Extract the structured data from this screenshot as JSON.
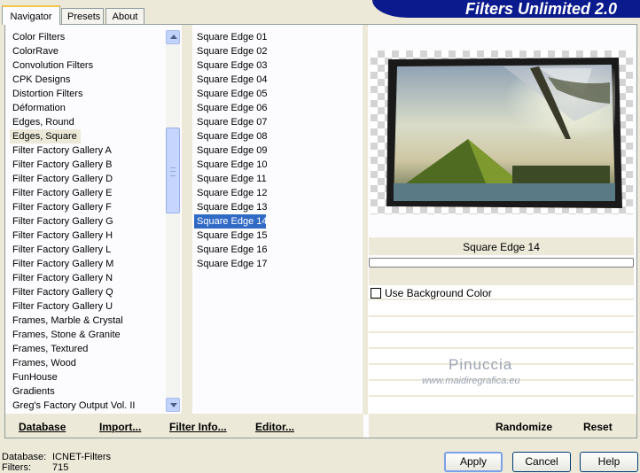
{
  "title": "Filters Unlimited 2.0",
  "tabs": [
    {
      "label": "Navigator"
    },
    {
      "label": "Presets"
    },
    {
      "label": "About"
    }
  ],
  "categories": [
    "Color Filters",
    "ColorRave",
    "Convolution Filters",
    "CPK Designs",
    "Distortion Filters",
    "Déformation",
    "Edges, Round",
    "Edges, Square",
    "Filter Factory Gallery A",
    "Filter Factory Gallery B",
    "Filter Factory Gallery D",
    "Filter Factory Gallery E",
    "Filter Factory Gallery F",
    "Filter Factory Gallery G",
    "Filter Factory Gallery H",
    "Filter Factory Gallery L",
    "Filter Factory Gallery M",
    "Filter Factory Gallery N",
    "Filter Factory Gallery Q",
    "Filter Factory Gallery U",
    "Frames, Marble & Crystal",
    "Frames, Stone & Granite",
    "Frames, Textured",
    "Frames, Wood",
    "FunHouse",
    "Gradients",
    "Greg's Factory Output Vol. II"
  ],
  "selected_category": "Edges, Square",
  "filters": [
    "Square Edge 01",
    "Square Edge 02",
    "Square Edge 03",
    "Square Edge 04",
    "Square Edge 05",
    "Square Edge 06",
    "Square Edge 07",
    "Square Edge 08",
    "Square Edge 09",
    "Square Edge 10",
    "Square Edge 11",
    "Square Edge 12",
    "Square Edge 13",
    "Square Edge 14",
    "Square Edge 15",
    "Square Edge 16",
    "Square Edge 17"
  ],
  "selected_filter": "Square Edge 14",
  "preview_label": "Square Edge 14",
  "use_background_color": {
    "label": "Use Background Color",
    "checked": false
  },
  "watermark": {
    "name": "Pinuccia",
    "site": "www.maidiregrafica.eu"
  },
  "bottom_links": {
    "database": "Database",
    "import": "Import...",
    "filter_info": "Filter Info...",
    "editor": "Editor...",
    "randomize": "Randomize",
    "reset": "Reset"
  },
  "status": {
    "database_label": "Database:",
    "database_value": "ICNET-Filters",
    "filters_label": "Filters:",
    "filters_value": "715"
  },
  "buttons": {
    "apply": "Apply",
    "cancel": "Cancel",
    "help": "Help"
  },
  "colors": {
    "selection_blue": "#316ac5",
    "banner_blue": "#0b1a8c",
    "panel": "#ece9d8"
  }
}
